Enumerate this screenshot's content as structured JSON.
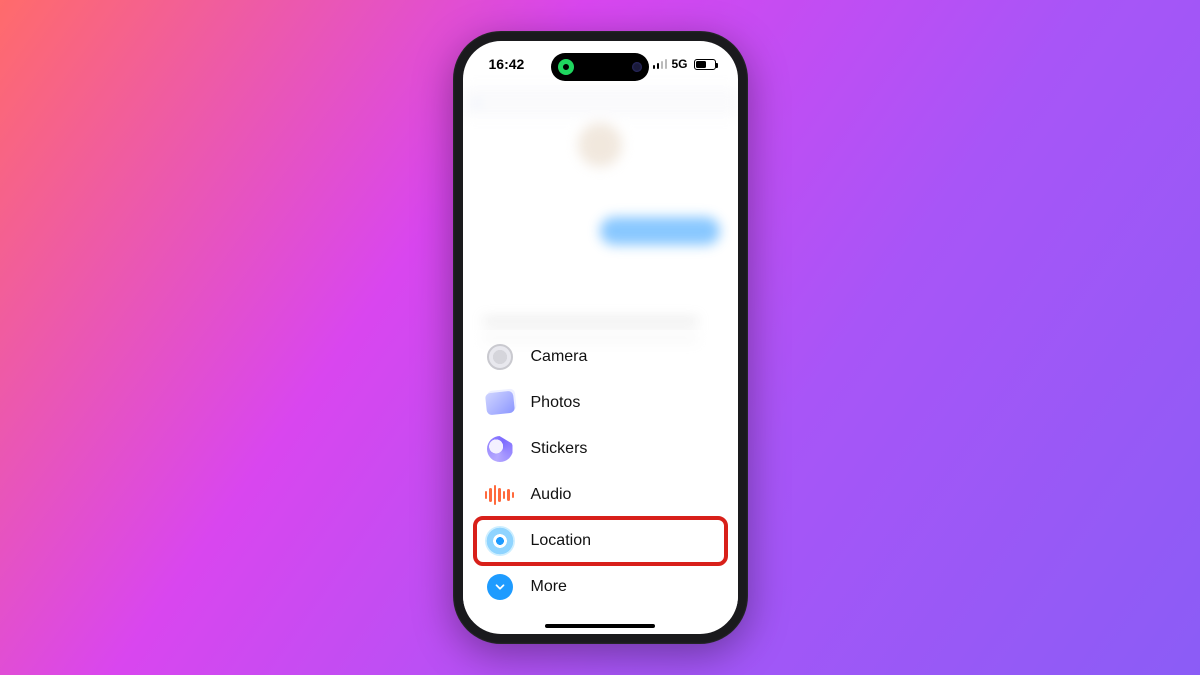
{
  "status": {
    "time": "16:42",
    "network": "5G"
  },
  "menu": {
    "camera": {
      "label": "Camera"
    },
    "photos": {
      "label": "Photos"
    },
    "stickers": {
      "label": "Stickers"
    },
    "audio": {
      "label": "Audio"
    },
    "location": {
      "label": "Location",
      "highlighted": true
    },
    "more": {
      "label": "More"
    }
  },
  "highlight_color": "#d8201a"
}
